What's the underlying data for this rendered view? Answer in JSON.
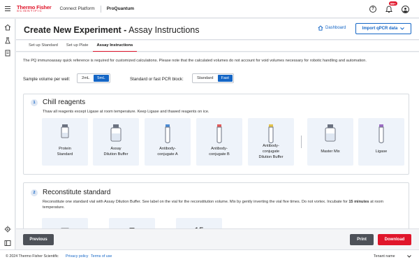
{
  "brand": {
    "line1": "Thermo Fisher",
    "line2": "SCIENTIFIC"
  },
  "topbar": {
    "platform": "Connect Platform",
    "product": "ProQuantum",
    "notification_badge": "99+"
  },
  "header": {
    "title_bold": "Create New Experiment -",
    "title_rest": " Assay Instructions",
    "dashboard": "Dashboard",
    "import_button": "Import qPCR data"
  },
  "tabs": [
    {
      "label": "Set up Standard"
    },
    {
      "label": "Set up Plate"
    },
    {
      "label": "Assay Instructions"
    }
  ],
  "notice": "The PQ immunoassay quick reference is required for customized calculations. Please note that the calculated volumes do not account for void volumes necessary for robotic handling and automation.",
  "sample_volume": {
    "label": "Sample volume per well:",
    "options": [
      "2mL",
      "5mL"
    ],
    "selected": "5mL"
  },
  "pcr_block": {
    "label": "Standard or fast PCR block:",
    "options": [
      "Standard",
      "Fast"
    ],
    "selected": "Fast"
  },
  "steps": [
    {
      "number": "1",
      "title": "Chill reagents",
      "description": "Thaw all reagents except Ligase at room temperature. Keep Ligase and thawed reagents on ice.",
      "tiles": [
        {
          "label1": "Protein",
          "label2": "Standard",
          "label3": ""
        },
        {
          "label1": "Assay",
          "label2": "Dilution Buffer",
          "label3": ""
        },
        {
          "label1": "Antibody-",
          "label2": "conjugate A",
          "label3": ""
        },
        {
          "label1": "Antibody-",
          "label2": "conjugate B",
          "label3": ""
        },
        {
          "label1": "Antibody-",
          "label2": "conjugate",
          "label3": "Dilution Buffer"
        },
        {
          "label1": "Master Mix",
          "label2": "",
          "label3": ""
        },
        {
          "label1": "Ligase",
          "label2": "",
          "label3": ""
        }
      ]
    },
    {
      "number": "2",
      "title": "Reconstitute standard",
      "description_part1": "Reconstitute one standard vial with Assay Dilution Buffer. See label on the vial for the reconstitution volume. Mix by gently inverting the vial five times. Do not vortex. Incubate for ",
      "description_bold": "15 minutes",
      "description_part2": " at room temperature.",
      "timer_text": "15"
    }
  ],
  "actions": {
    "previous": "Previous",
    "print": "Print",
    "download": "Download"
  },
  "footer": {
    "copyright": "© 2024 Thermo Fisher Scientific",
    "privacy": "Privacy policy",
    "terms": "Terms of use",
    "tenant": "Tenant name"
  },
  "colors": {
    "accent": "#1466c6",
    "brand_red": "#e0162b",
    "tile_bg": "#eef3fa"
  }
}
